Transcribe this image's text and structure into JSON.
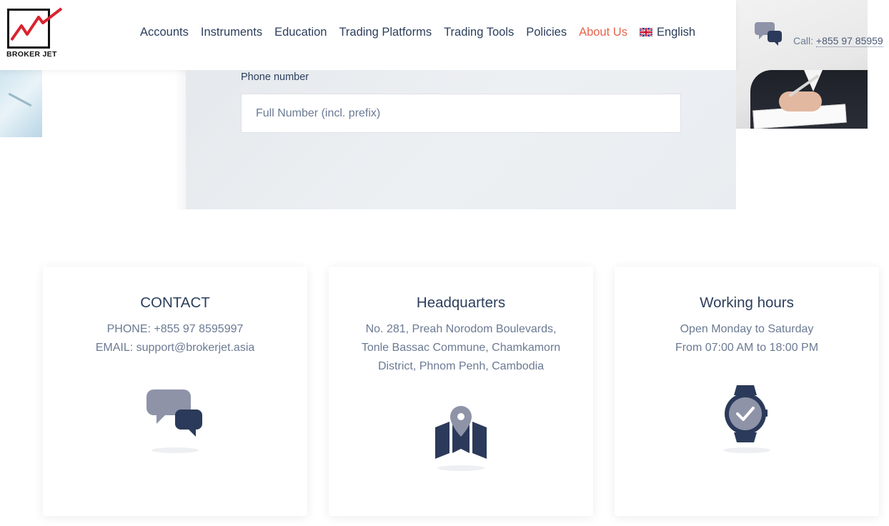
{
  "brand": {
    "logo_text": "BROKER JET"
  },
  "nav": {
    "items": [
      "Accounts",
      "Instruments",
      "Education",
      "Trading Platforms",
      "Trading Tools",
      "Policies",
      "About Us"
    ],
    "active": "About Us",
    "language": "English"
  },
  "header_contact": {
    "call_label": "Call:",
    "call_number": "+855 97 85959"
  },
  "form": {
    "phone_label": "Phone number",
    "phone_placeholder": "Full Number (incl. prefix)"
  },
  "cards": [
    {
      "title": "CONTACT",
      "lines": [
        "PHONE: +855 97 8595997",
        "EMAIL: support@brokerjet.asia"
      ],
      "icon": "chat-bubbles-icon"
    },
    {
      "title": "Headquarters",
      "lines": [
        "No. 281, Preah Norodom Boulevards,",
        "Tonle Bassac Commune, Chamkamorn",
        "District, Phnom Penh, Cambodia"
      ],
      "icon": "map-pin-icon"
    },
    {
      "title": "Working hours",
      "lines": [
        "Open Monday to Saturday",
        "From 07:00 AM to 18:00 PM"
      ],
      "icon": "watch-icon"
    }
  ],
  "colors": {
    "text_dark": "#2c3e5c",
    "text_muted": "#6b7a93",
    "accent": "#e8654c",
    "icon_light": "#8e93a8",
    "icon_dark": "#2b3a5a"
  }
}
